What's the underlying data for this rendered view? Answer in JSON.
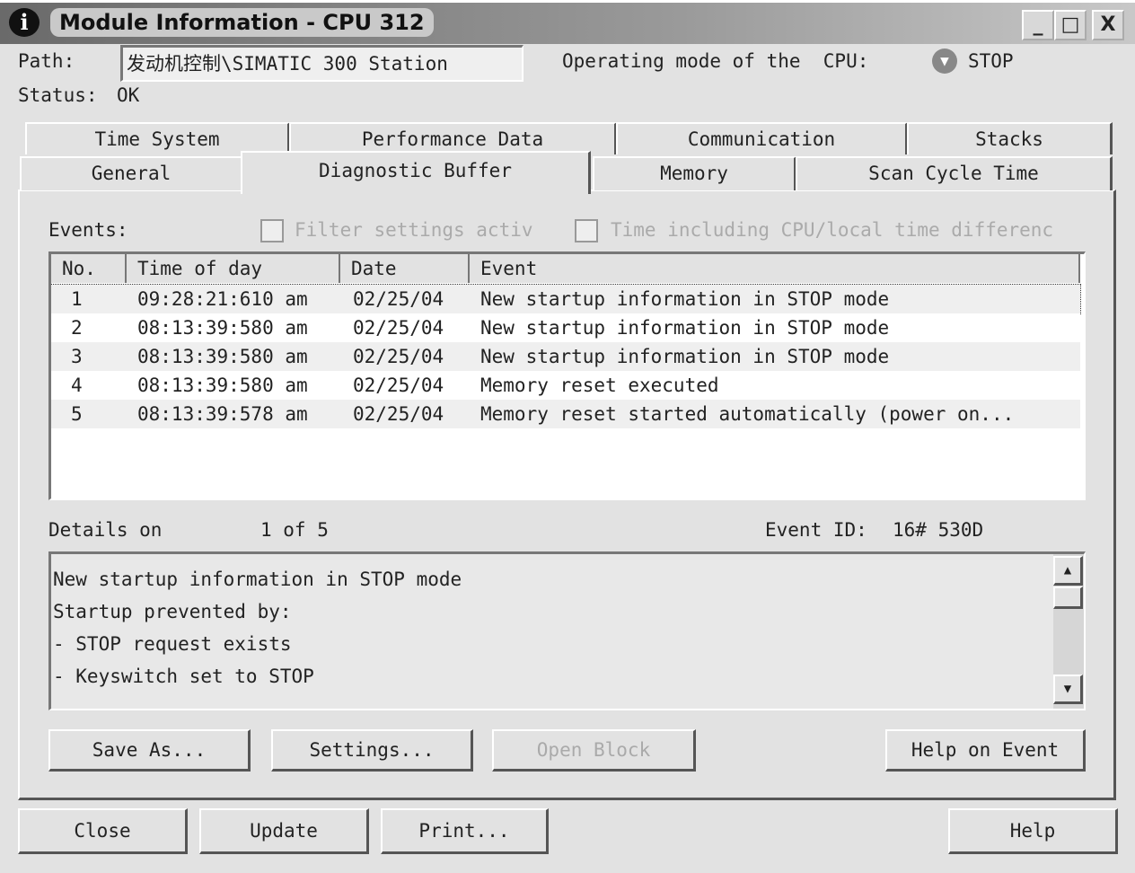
{
  "window": {
    "title": "Module Information - CPU 312",
    "minimize": "_",
    "maximize": "□",
    "close": "X",
    "icon": "info-icon"
  },
  "header": {
    "path_label": "Path:",
    "path_value": "发动机控制\\SIMATIC 300 Station",
    "mode_label": "Operating mode of the  CPU:",
    "mode_value": "STOP",
    "status_label": "Status:",
    "status_value": "OK"
  },
  "tabs_row1": [
    "Time System",
    "Performance Data",
    "Communication",
    "Stacks"
  ],
  "tabs_row2": [
    "General",
    "Diagnostic Buffer",
    "Memory",
    "Scan Cycle Time"
  ],
  "active_tab": "Diagnostic Buffer",
  "events": {
    "label": "Events:",
    "filter_label": "Filter settings activ",
    "filter_checked": false,
    "time_label": "Time including CPU/local time differenc",
    "time_checked": false,
    "columns": [
      "No.",
      "Time of day",
      "Date",
      "Event"
    ],
    "rows": [
      {
        "no": "1",
        "time": "09:28:21:610 am",
        "date": "02/25/04",
        "event": "New startup information in STOP mode"
      },
      {
        "no": "2",
        "time": "08:13:39:580 am",
        "date": "02/25/04",
        "event": "New startup information in STOP mode"
      },
      {
        "no": "3",
        "time": "08:13:39:580 am",
        "date": "02/25/04",
        "event": "New startup information in STOP mode"
      },
      {
        "no": "4",
        "time": "08:13:39:580 am",
        "date": "02/25/04",
        "event": "Memory reset executed"
      },
      {
        "no": "5",
        "time": "08:13:39:578 am",
        "date": "02/25/04",
        "event": "Memory reset started automatically  (power on..."
      }
    ]
  },
  "details": {
    "label": "Details on",
    "position": "1 of 5",
    "event_id_label": "Event ID:",
    "event_id": "16# 530D",
    "lines": [
      "New startup information in STOP mode",
      "Startup prevented by:",
      "- STOP request exists",
      "- Keyswitch set to STOP"
    ]
  },
  "panel_buttons": {
    "save_as": "Save As...",
    "settings": "Settings...",
    "open_block": "Open Block",
    "help_on_event": "Help on Event"
  },
  "bottom_buttons": {
    "close": "Close",
    "update": "Update",
    "print": "Print...",
    "help": "Help"
  }
}
